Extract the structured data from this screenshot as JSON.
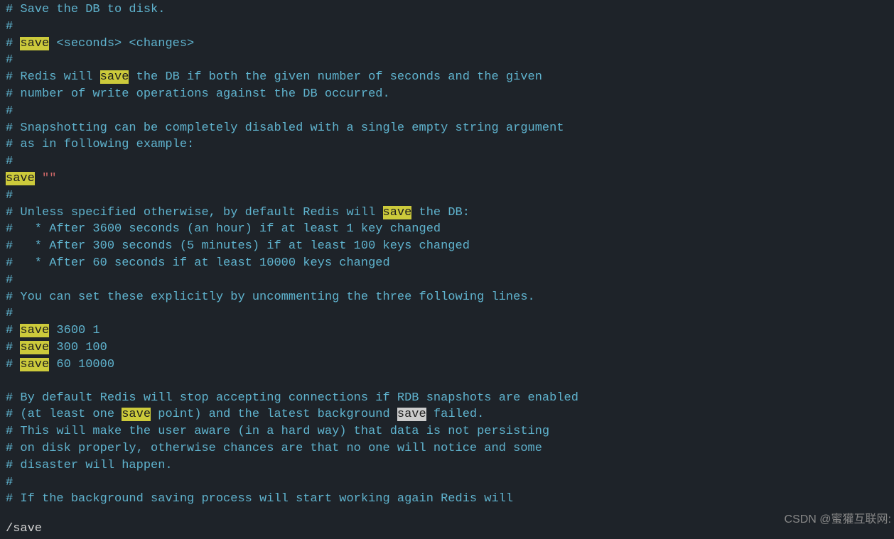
{
  "search_term": "save",
  "status_line": "/save",
  "watermark": "CSDN @蜜獾互联网:",
  "lines": [
    {
      "segments": [
        {
          "text": "# Save the DB to disk.",
          "class": "comment"
        }
      ]
    },
    {
      "segments": [
        {
          "text": "#",
          "class": "comment"
        }
      ]
    },
    {
      "segments": [
        {
          "text": "# ",
          "class": "comment"
        },
        {
          "text": "save",
          "class": "highlight"
        },
        {
          "text": " <seconds> <changes>",
          "class": "comment"
        }
      ]
    },
    {
      "segments": [
        {
          "text": "#",
          "class": "comment"
        }
      ]
    },
    {
      "segments": [
        {
          "text": "# Redis will ",
          "class": "comment"
        },
        {
          "text": "save",
          "class": "highlight"
        },
        {
          "text": " the DB if both the given number of seconds and the given",
          "class": "comment"
        }
      ]
    },
    {
      "segments": [
        {
          "text": "# number of write operations against the DB occurred.",
          "class": "comment"
        }
      ]
    },
    {
      "segments": [
        {
          "text": "#",
          "class": "comment"
        }
      ]
    },
    {
      "segments": [
        {
          "text": "# Snapshotting can be completely disabled with a single empty string argument",
          "class": "comment"
        }
      ]
    },
    {
      "segments": [
        {
          "text": "# as in following example:",
          "class": "comment"
        }
      ]
    },
    {
      "segments": [
        {
          "text": "#",
          "class": "comment"
        }
      ]
    },
    {
      "segments": [
        {
          "text": "save",
          "class": "highlight"
        },
        {
          "text": " ",
          "class": "comment"
        },
        {
          "text": "\"\"",
          "class": "red-text"
        }
      ]
    },
    {
      "segments": [
        {
          "text": "#",
          "class": "comment"
        }
      ]
    },
    {
      "segments": [
        {
          "text": "# Unless specified otherwise, by default Redis will ",
          "class": "comment"
        },
        {
          "text": "save",
          "class": "highlight"
        },
        {
          "text": " the DB:",
          "class": "comment"
        }
      ]
    },
    {
      "segments": [
        {
          "text": "#   * After 3600 seconds (an hour) if at least 1 key changed",
          "class": "comment"
        }
      ]
    },
    {
      "segments": [
        {
          "text": "#   * After 300 seconds (5 minutes) if at least 100 keys changed",
          "class": "comment"
        }
      ]
    },
    {
      "segments": [
        {
          "text": "#   * After 60 seconds if at least 10000 keys changed",
          "class": "comment"
        }
      ]
    },
    {
      "segments": [
        {
          "text": "#",
          "class": "comment"
        }
      ]
    },
    {
      "segments": [
        {
          "text": "# You can set these explicitly by uncommenting the three following lines.",
          "class": "comment"
        }
      ]
    },
    {
      "segments": [
        {
          "text": "#",
          "class": "comment"
        }
      ]
    },
    {
      "segments": [
        {
          "text": "# ",
          "class": "comment"
        },
        {
          "text": "save",
          "class": "highlight"
        },
        {
          "text": " 3600 1",
          "class": "comment"
        }
      ]
    },
    {
      "segments": [
        {
          "text": "# ",
          "class": "comment"
        },
        {
          "text": "save",
          "class": "highlight"
        },
        {
          "text": " 300 100",
          "class": "comment"
        }
      ]
    },
    {
      "segments": [
        {
          "text": "# ",
          "class": "comment"
        },
        {
          "text": "save",
          "class": "highlight"
        },
        {
          "text": " 60 10000",
          "class": "comment"
        }
      ]
    },
    {
      "segments": [
        {
          "text": "",
          "class": "comment"
        }
      ]
    },
    {
      "segments": [
        {
          "text": "# By default Redis will stop accepting connections if RDB snapshots are enabled",
          "class": "comment"
        }
      ]
    },
    {
      "segments": [
        {
          "text": "# (at least one ",
          "class": "comment"
        },
        {
          "text": "save",
          "class": "highlight"
        },
        {
          "text": " point) and the latest background ",
          "class": "comment"
        },
        {
          "text": "save",
          "class": "highlight-cursor"
        },
        {
          "text": " failed.",
          "class": "comment"
        }
      ]
    },
    {
      "segments": [
        {
          "text": "# This will make the user aware (in a hard way) that data is not persisting",
          "class": "comment"
        }
      ]
    },
    {
      "segments": [
        {
          "text": "# on disk properly, otherwise chances are that no one will notice and some",
          "class": "comment"
        }
      ]
    },
    {
      "segments": [
        {
          "text": "# disaster will happen.",
          "class": "comment"
        }
      ]
    },
    {
      "segments": [
        {
          "text": "#",
          "class": "comment"
        }
      ]
    },
    {
      "segments": [
        {
          "text": "# If the background saving process will start working again Redis will",
          "class": "comment"
        }
      ]
    }
  ]
}
